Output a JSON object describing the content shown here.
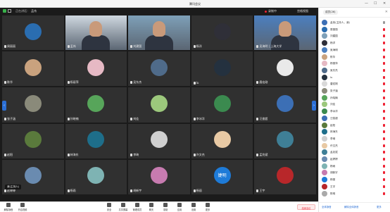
{
  "window": {
    "title": "腾讯会议",
    "controls": [
      "—",
      "☐",
      "✕"
    ]
  },
  "video_topbar": {
    "speaking_prefix": "正在讲话：",
    "speaking_name": "孟伟",
    "record_label": "录制中",
    "grid_view_label": "宫格视图"
  },
  "tiles": [
    {
      "name": "周丽丽",
      "kind": "avatar",
      "color": "#2a6db0",
      "mic": "on"
    },
    {
      "name": "孟伟",
      "kind": "video",
      "color": "#cfd8e0",
      "mic": "on"
    },
    {
      "name": "刘建国",
      "kind": "video",
      "color": "#7ea0b8",
      "mic": "on"
    },
    {
      "name": "杨洋",
      "kind": "avatar",
      "color": "#2f2f38",
      "mic": "on"
    },
    {
      "name": "吴海明 | 上海大学",
      "kind": "video",
      "color": "#4b7fbf",
      "mic": "on"
    },
    {
      "name": "陈华",
      "kind": "avatar",
      "color": "#c9a27e",
      "mic": "on"
    },
    {
      "name": "杨丽萍",
      "kind": "avatar",
      "color": "#e6b9c4",
      "mic": "on"
    },
    {
      "name": "吴东杰",
      "kind": "avatar",
      "color": "#4f6b8a",
      "mic": "on"
    },
    {
      "name": "lu",
      "kind": "avatar",
      "color": "#24313f",
      "mic": "on"
    },
    {
      "name": "唐宏刚",
      "kind": "avatar",
      "color": "#e9e9e9",
      "mic": "on"
    },
    {
      "name": "张子涵",
      "kind": "avatar",
      "color": "#8a8a7a",
      "mic": "on"
    },
    {
      "name": "孙晓楠",
      "kind": "avatar",
      "color": "#57a55a",
      "mic": "on"
    },
    {
      "name": "刘佳",
      "kind": "avatar",
      "color": "#9cc87c",
      "mic": "on"
    },
    {
      "name": "李冰洋",
      "kind": "avatar",
      "color": "#3b8a4f",
      "mic": "on"
    },
    {
      "name": "汪俊超",
      "kind": "avatar",
      "color": "#3c6fb5",
      "mic": "on"
    },
    {
      "name": "赵阳",
      "kind": "avatar",
      "color": "#5a7a3c",
      "mic": "on"
    },
    {
      "name": "林海东",
      "kind": "avatar",
      "color": "#1e6e8a",
      "mic": "on"
    },
    {
      "name": "李琦",
      "kind": "avatar",
      "color": "#cfcfcf",
      "mic": "on"
    },
    {
      "name": "许文杰",
      "kind": "avatar",
      "color": "#e8c9a4",
      "mic": "on"
    },
    {
      "name": "孟兆斌",
      "kind": "avatar",
      "color": "#3f7f96",
      "mic": "on"
    },
    {
      "name": "赵婷婷",
      "kind": "avatar",
      "color": "#6a8bb0",
      "mic": "on"
    },
    {
      "name": "杨雨",
      "kind": "avatar",
      "color": "#7eb3b3",
      "mic": "on"
    },
    {
      "name": "胡新宇",
      "kind": "avatar",
      "color": "#c77bb0",
      "mic": "on"
    },
    {
      "name": "杨丽",
      "kind": "avatar",
      "color": "#1e7bd8",
      "letter": "婕明",
      "mic": "on"
    },
    {
      "name": "王宇",
      "kind": "avatar",
      "color": "#b8272a",
      "mic": "on"
    }
  ],
  "self_label": "我(主持人)",
  "toolbar": {
    "left": [
      {
        "icon": "mic-icon",
        "label": "解除静音"
      },
      {
        "icon": "camera-icon",
        "label": "开启视频"
      }
    ],
    "center": [
      {
        "icon": "security-icon",
        "label": "安全"
      },
      {
        "icon": "share-icon",
        "label": "共享屏幕"
      },
      {
        "icon": "members-icon",
        "label": "管理成员"
      },
      {
        "icon": "chat-icon",
        "label": "聊天"
      },
      {
        "icon": "record-icon",
        "label": "录制"
      },
      {
        "icon": "apps-icon",
        "label": "应用"
      },
      {
        "icon": "settings-icon",
        "label": "设置"
      },
      {
        "icon": "more-icon",
        "label": "更多"
      }
    ],
    "leave_label": "结束会议"
  },
  "panel": {
    "tab_label": "成员(26)",
    "members": [
      {
        "name": "孟伟(主持人，我)",
        "color": "#3c6fb5",
        "mic": "on"
      },
      {
        "name": "周丽丽",
        "color": "#2a6db0",
        "mic": "off"
      },
      {
        "name": "刘建国",
        "color": "#7ea0b8",
        "mic": "off"
      },
      {
        "name": "杨洋",
        "color": "#2f2f38",
        "mic": "off"
      },
      {
        "name": "吴海明",
        "color": "#4b7fbf",
        "mic": "off"
      },
      {
        "name": "陈华",
        "color": "#c9a27e",
        "mic": "off"
      },
      {
        "name": "杨丽萍",
        "color": "#e6b9c4",
        "mic": "off"
      },
      {
        "name": "吴东杰",
        "color": "#4f6b8a",
        "mic": "off"
      },
      {
        "name": "lu",
        "color": "#24313f",
        "mic": "off"
      },
      {
        "name": "唐宏刚",
        "color": "#d9d9d9",
        "mic": "off"
      },
      {
        "name": "张子涵",
        "color": "#8a8a7a",
        "mic": "off"
      },
      {
        "name": "孙晓楠",
        "color": "#57a55a",
        "mic": "off"
      },
      {
        "name": "刘佳",
        "color": "#9cc87c",
        "mic": "off"
      },
      {
        "name": "李冰洋",
        "color": "#3b8a4f",
        "mic": "off"
      },
      {
        "name": "汪俊超",
        "color": "#3c6fb5",
        "mic": "off"
      },
      {
        "name": "赵阳",
        "color": "#5a7a3c",
        "mic": "off"
      },
      {
        "name": "林海东",
        "color": "#1e6e8a",
        "mic": "off"
      },
      {
        "name": "李琦",
        "color": "#cfcfcf",
        "mic": "off"
      },
      {
        "name": "许文杰",
        "color": "#e8c9a4",
        "mic": "off"
      },
      {
        "name": "孟兆斌",
        "color": "#3f7f96",
        "mic": "off"
      },
      {
        "name": "赵婷婷",
        "color": "#6a8bb0",
        "mic": "off"
      },
      {
        "name": "杨雨",
        "color": "#7eb3b3",
        "mic": "off"
      },
      {
        "name": "胡新宇",
        "color": "#c77bb0",
        "mic": "off"
      },
      {
        "name": "杨丽",
        "color": "#1e7bd8",
        "mic": "off"
      },
      {
        "name": "王宇",
        "color": "#b8272a",
        "mic": "off"
      },
      {
        "name": "陈明",
        "color": "#aaaaaa",
        "mic": "off"
      }
    ],
    "footer": {
      "mute_all": "全体静音",
      "unmute_all": "解除全体静音",
      "more": "更多"
    }
  }
}
